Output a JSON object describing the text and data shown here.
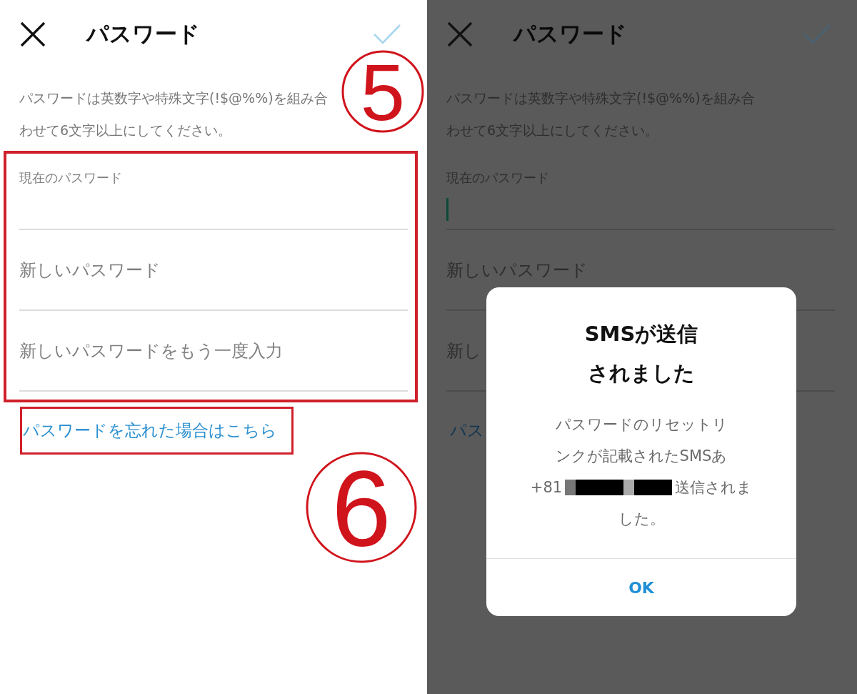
{
  "panels": [
    {
      "dimmed": false,
      "header": {
        "title": "パスワード"
      },
      "description": "パスワードは英数字や特殊文字(!$@%%)を組み合わせて6文字以上にしてください。",
      "fields_highlighted": true,
      "fields": [
        {
          "label": "現在のパスワード",
          "focused": false
        },
        {
          "placeholder": "新しいパスワード"
        },
        {
          "placeholder": "新しいパスワードをもう一度入力"
        }
      ],
      "link": {
        "text": "パスワードを忘れた場合はこちら",
        "highlighted": true
      },
      "annotations": [
        {
          "kind": "circled-number",
          "text": "5"
        },
        {
          "kind": "circled-number",
          "text": "6"
        }
      ]
    },
    {
      "dimmed": true,
      "header": {
        "title": "パスワード"
      },
      "description": "パスワードは英数字や特殊文字(!$@%%)を組み合わせて6文字以上にしてください。",
      "fields_highlighted": false,
      "fields": [
        {
          "label": "現在のパスワード",
          "focused": true
        },
        {
          "placeholder": "新しいパスワード"
        },
        {
          "placeholder": "新し"
        }
      ],
      "link": {
        "text": "パス",
        "highlighted": false
      },
      "dialog": {
        "title_lines": [
          "SMSが送信",
          "されました"
        ],
        "message_lines": [
          {
            "text": "パスワードのリセットリ",
            "redacted": false
          },
          {
            "text": "ンクが記載されたSMSあ",
            "redacted": false
          },
          {
            "text": "+81",
            "redacted": true,
            "after": "送信されま"
          },
          {
            "text": "した。",
            "redacted": false
          }
        ],
        "button": "OK"
      }
    }
  ]
}
